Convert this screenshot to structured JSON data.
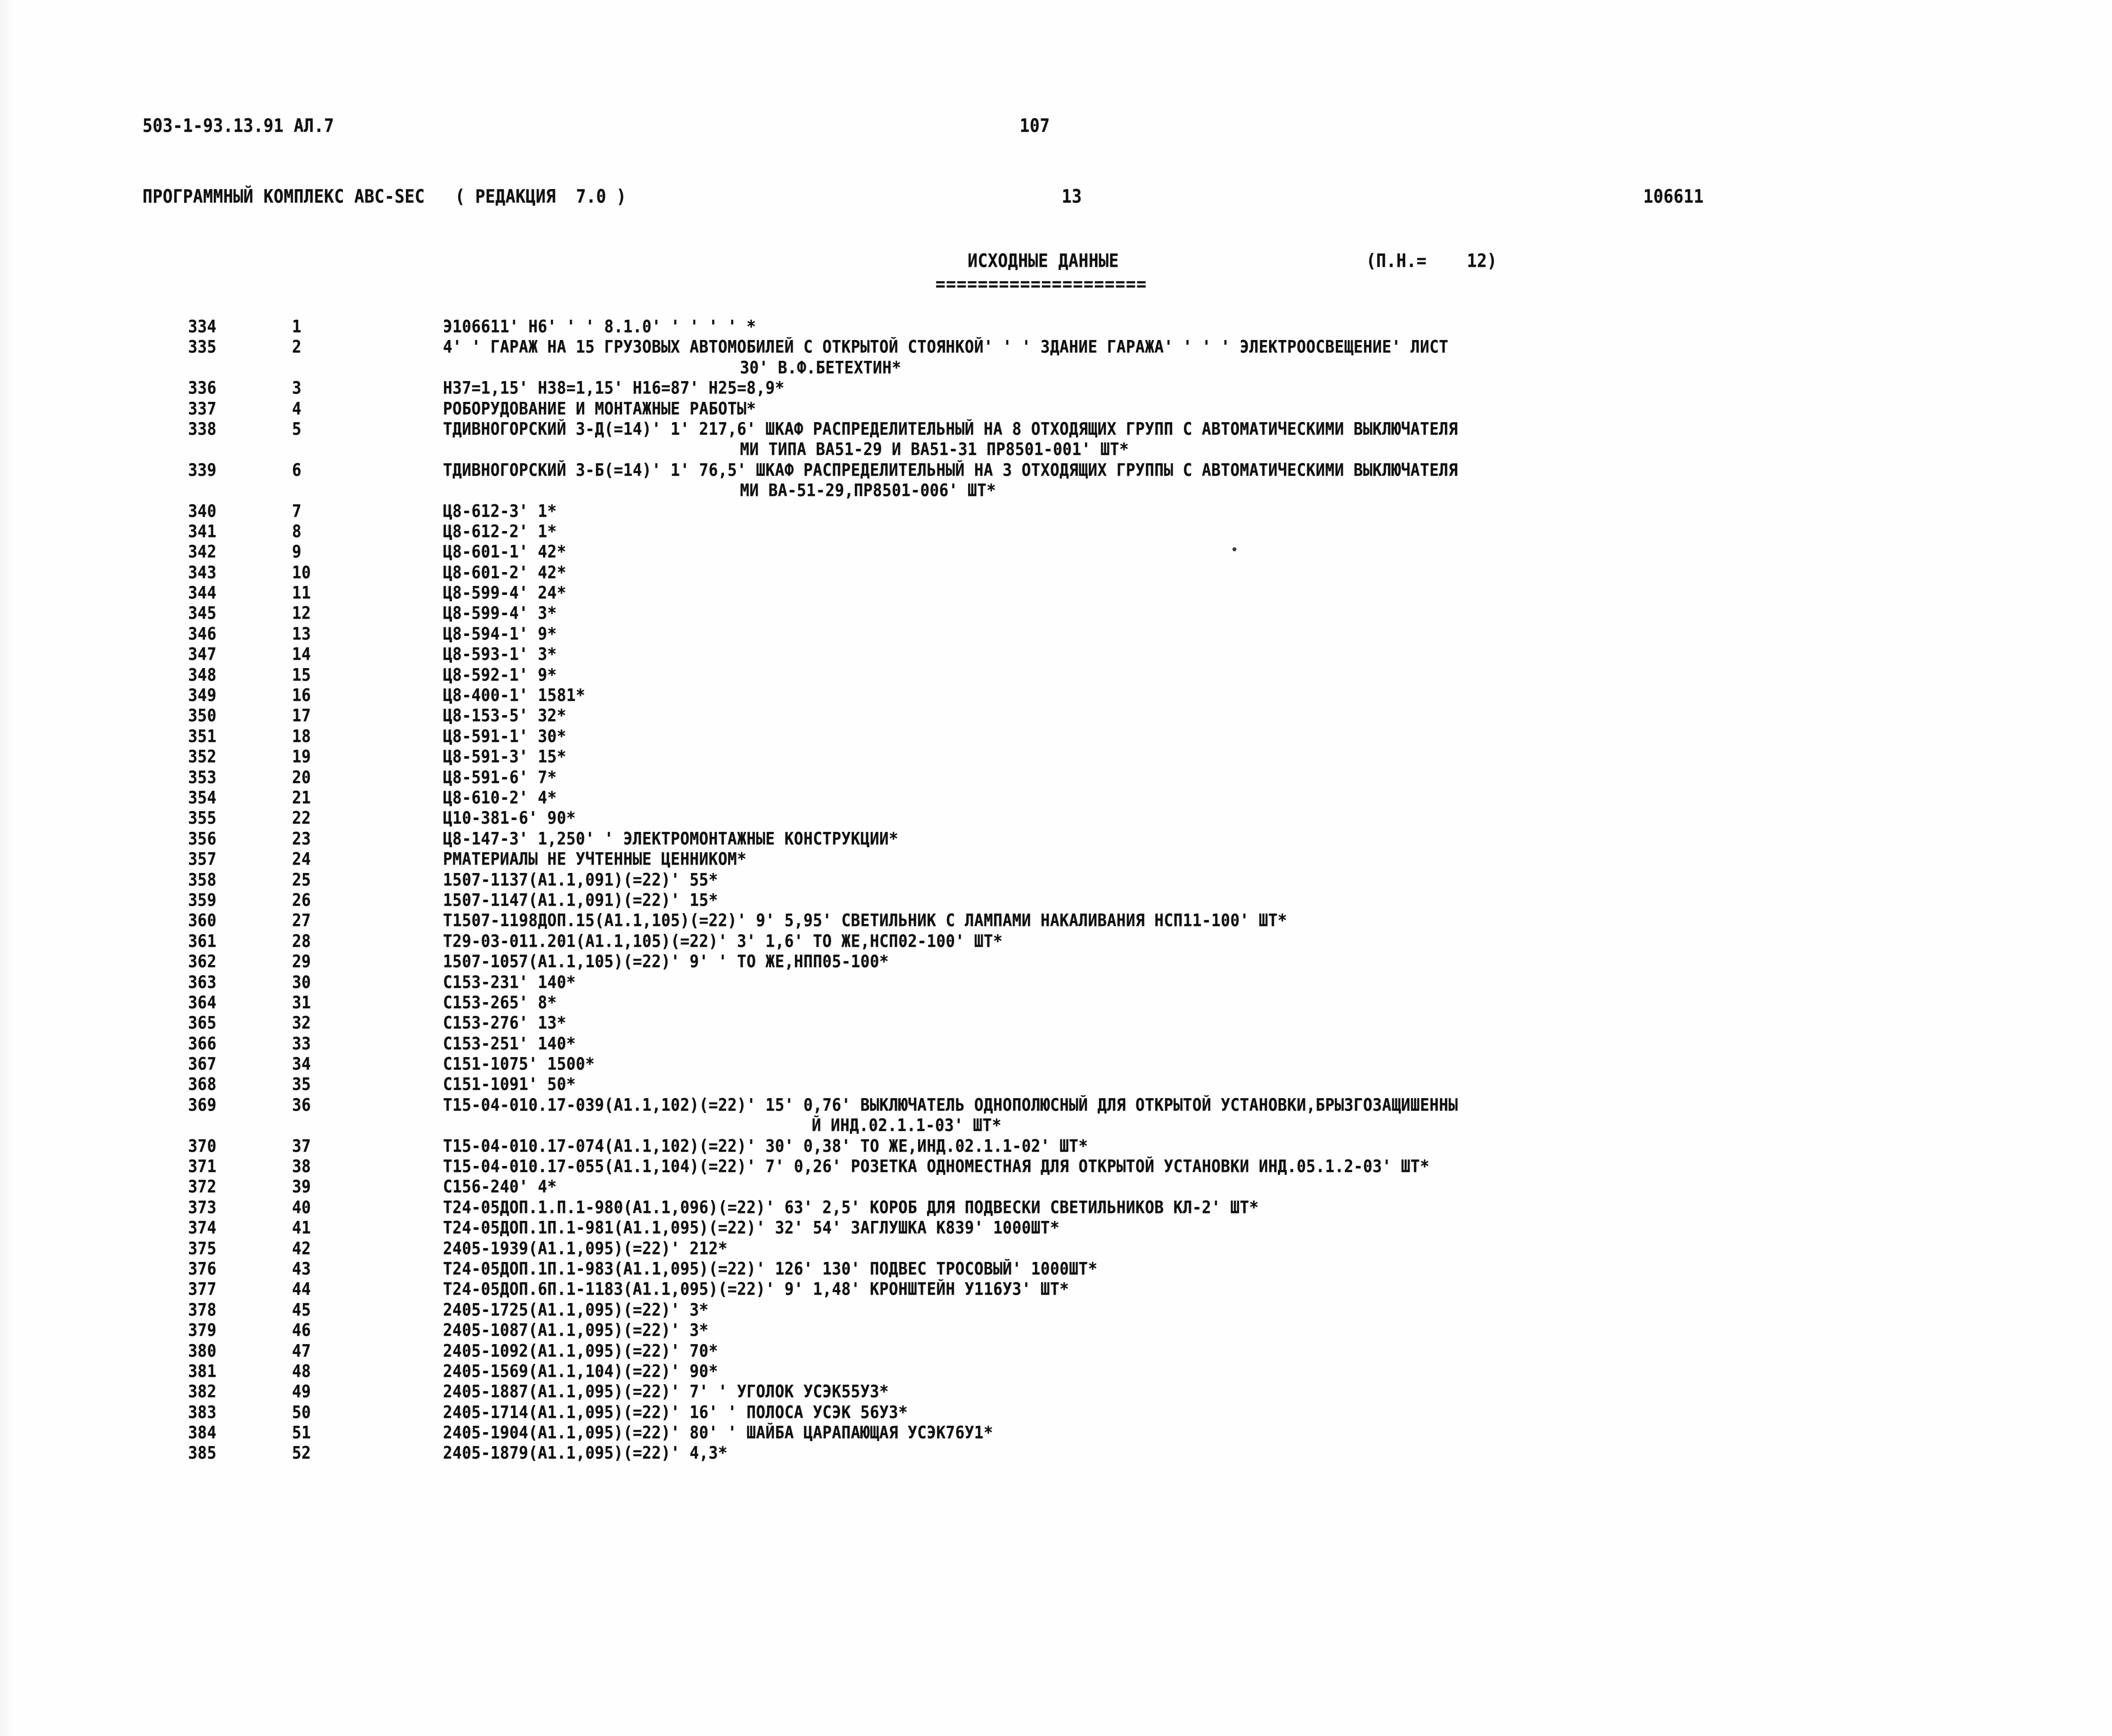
{
  "header": {
    "doc_code": "503-1-93.13.91 АЛ.7",
    "page_number_top": "107",
    "software_title": "ПРОГРАММНЫЙ КОМПЛЕКС АВС-SEC   ( РЕДАКЦИЯ  7.0 )",
    "sheet_number": "13",
    "object_code": "106611"
  },
  "section": {
    "title": "ИСХОДНЫЕ ДАННЫЕ",
    "underline": "====================",
    "param": "(П.Н.=    12)"
  },
  "listing": {
    "rows": [
      {
        "seq": "334",
        "num": "1",
        "text": "Э106611' Н6' ' ' 8.1.0' ' ' ' ' *"
      },
      {
        "seq": "335",
        "num": "2",
        "text": "4' ' ГАРАЖ НА 15 ГРУЗОВЫХ АВТОМОБИЛЕЙ С ОТКРЫТОЙ СТОЯНКОЙ' ' ' ЗДАНИЕ ГАРАЖА' ' ' ' ЭЛЕКТРООСВЕЩЕНИЕ' ЛИСТ",
        "cont": "30' В.Ф.БЕТЕХТИН*"
      },
      {
        "seq": "336",
        "num": "3",
        "text": "Н37=1,15' Н38=1,15' Н16=87' Н25=8,9*"
      },
      {
        "seq": "337",
        "num": "4",
        "text": "РОБОРУДОВАНИЕ И МОНТАЖНЫЕ РАБОТЫ*"
      },
      {
        "seq": "338",
        "num": "5",
        "text": "ТДИВНОГОРСКИЙ 3-Д(=14)' 1' 217,6' ШКАФ РАСПРЕДЕЛИТЕЛЬНЫЙ НА 8 ОТХОДЯЩИХ ГРУПП С АВТОМАТИЧЕСКИМИ ВЫКЛЮЧАТЕЛЯ",
        "cont": "МИ ТИПА ВА51-29 И ВА51-31 ПР8501-001' ШТ*"
      },
      {
        "seq": "339",
        "num": "6",
        "text": "ТДИВНОГОРСКИЙ 3-Б(=14)' 1' 76,5' ШКАФ РАСПРЕДЕЛИТЕЛЬНЫЙ НА 3 ОТХОДЯЩИХ ГРУППЫ С АВТОМАТИЧЕСКИМИ ВЫКЛЮЧАТЕЛЯ",
        "cont": "МИ ВА-51-29,ПР8501-006' ШТ*"
      },
      {
        "seq": "340",
        "num": "7",
        "text": "Ц8-612-3' 1*"
      },
      {
        "seq": "341",
        "num": "8",
        "text": "Ц8-612-2' 1*"
      },
      {
        "seq": "342",
        "num": "9",
        "text": "Ц8-601-1' 42*"
      },
      {
        "seq": "343",
        "num": "10",
        "text": "Ц8-601-2' 42*"
      },
      {
        "seq": "344",
        "num": "11",
        "text": "Ц8-599-4' 24*"
      },
      {
        "seq": "345",
        "num": "12",
        "text": "Ц8-599-4' 3*"
      },
      {
        "seq": "346",
        "num": "13",
        "text": "Ц8-594-1' 9*"
      },
      {
        "seq": "347",
        "num": "14",
        "text": "Ц8-593-1' 3*"
      },
      {
        "seq": "348",
        "num": "15",
        "text": "Ц8-592-1' 9*"
      },
      {
        "seq": "349",
        "num": "16",
        "text": "Ц8-400-1' 1581*"
      },
      {
        "seq": "350",
        "num": "17",
        "text": "Ц8-153-5' 32*"
      },
      {
        "seq": "351",
        "num": "18",
        "text": "Ц8-591-1' 30*"
      },
      {
        "seq": "352",
        "num": "19",
        "text": "Ц8-591-3' 15*"
      },
      {
        "seq": "353",
        "num": "20",
        "text": "Ц8-591-6' 7*"
      },
      {
        "seq": "354",
        "num": "21",
        "text": "Ц8-610-2' 4*"
      },
      {
        "seq": "355",
        "num": "22",
        "text": "Ц10-381-6' 90*"
      },
      {
        "seq": "356",
        "num": "23",
        "text": "Ц8-147-3' 1,250' ' ЭЛЕКТРОМОНТАЖНЫЕ КОНСТРУКЦИИ*"
      },
      {
        "seq": "357",
        "num": "24",
        "text": "РМАТЕРИАЛЫ НЕ УЧТЕННЫЕ ЦЕННИКОМ*"
      },
      {
        "seq": "358",
        "num": "25",
        "text": "1507-1137(А1.1,091)(=22)' 55*"
      },
      {
        "seq": "359",
        "num": "26",
        "text": "1507-1147(А1.1,091)(=22)' 15*"
      },
      {
        "seq": "360",
        "num": "27",
        "text": "Т1507-1198ДОП.15(А1.1,105)(=22)' 9' 5,95' СВЕТИЛЬНИК С ЛАМПАМИ НАКАЛИВАНИЯ НСП11-100' ШТ*"
      },
      {
        "seq": "361",
        "num": "28",
        "text": "Т29-03-011.201(А1.1,105)(=22)' 3' 1,6' ТО ЖЕ,НСП02-100' ШТ*"
      },
      {
        "seq": "362",
        "num": "29",
        "text": "1507-1057(А1.1,105)(=22)' 9' ' ТО ЖЕ,НПП05-100*"
      },
      {
        "seq": "363",
        "num": "30",
        "text": "С153-231' 140*"
      },
      {
        "seq": "364",
        "num": "31",
        "text": "С153-265' 8*"
      },
      {
        "seq": "365",
        "num": "32",
        "text": "С153-276' 13*"
      },
      {
        "seq": "366",
        "num": "33",
        "text": "С153-251' 140*"
      },
      {
        "seq": "367",
        "num": "34",
        "text": "С151-1075' 1500*"
      },
      {
        "seq": "368",
        "num": "35",
        "text": "С151-1091' 50*"
      },
      {
        "seq": "369",
        "num": "36",
        "text": "Т15-04-010.17-039(А1.1,102)(=22)' 15' 0,76' ВЫКЛЮЧАТЕЛЬ ОДНОПОЛЮСНЫЙ ДЛЯ ОТКРЫТОЙ УСТАНОВКИ,БРЫЗГОЗАЩИШЕННЫ",
        "cont2": "Й ИНД.02.1.1-03' ШТ*"
      },
      {
        "seq": "370",
        "num": "37",
        "text": "Т15-04-010.17-074(А1.1,102)(=22)' 30' 0,38' ТО ЖЕ,ИНД.02.1.1-02' ШТ*"
      },
      {
        "seq": "371",
        "num": "38",
        "text": "Т15-04-010.17-055(А1.1,104)(=22)' 7' 0,26' РОЗЕТКА ОДНОМЕСТНАЯ ДЛЯ ОТКРЫТОЙ УСТАНОВКИ ИНД.05.1.2-03' ШТ*"
      },
      {
        "seq": "372",
        "num": "39",
        "text": "С156-240' 4*"
      },
      {
        "seq": "373",
        "num": "40",
        "text": "Т24-05ДОП.1.П.1-980(А1.1,096)(=22)' 63' 2,5' КОРОБ ДЛЯ ПОДВЕСКИ СВЕТИЛЬНИКОВ КЛ-2' ШТ*"
      },
      {
        "seq": "374",
        "num": "41",
        "text": "Т24-05ДОП.1П.1-981(А1.1,095)(=22)' 32' 54' ЗАГЛУШКА К839' 1000ШТ*"
      },
      {
        "seq": "375",
        "num": "42",
        "text": "2405-1939(А1.1,095)(=22)' 212*"
      },
      {
        "seq": "376",
        "num": "43",
        "text": "Т24-05ДОП.1П.1-983(А1.1,095)(=22)' 126' 130' ПОДВЕС ТРОСОВЫЙ' 1000ШТ*"
      },
      {
        "seq": "377",
        "num": "44",
        "text": "Т24-05ДОП.6П.1-1183(А1.1,095)(=22)' 9' 1,48' КРОНШТЕЙН У116У3' ШТ*"
      },
      {
        "seq": "378",
        "num": "45",
        "text": "2405-1725(А1.1,095)(=22)' 3*"
      },
      {
        "seq": "379",
        "num": "46",
        "text": "2405-1087(А1.1,095)(=22)' 3*"
      },
      {
        "seq": "380",
        "num": "47",
        "text": "2405-1092(А1.1,095)(=22)' 70*"
      },
      {
        "seq": "381",
        "num": "48",
        "text": "2405-1569(А1.1,104)(=22)' 90*"
      },
      {
        "seq": "382",
        "num": "49",
        "text": "2405-1887(А1.1,095)(=22)' 7' ' УГОЛОК УСЭК55У3*"
      },
      {
        "seq": "383",
        "num": "50",
        "text": "2405-1714(А1.1,095)(=22)' 16' ' ПОЛОСА УСЭК 56У3*"
      },
      {
        "seq": "384",
        "num": "51",
        "text": "2405-1904(А1.1,095)(=22)' 80' ' ШАЙБА ЦАРАПАЮЩАЯ УСЭК76У1*"
      },
      {
        "seq": "385",
        "num": "52",
        "text": "2405-1879(А1.1,095)(=22)' 4,3*"
      }
    ]
  }
}
